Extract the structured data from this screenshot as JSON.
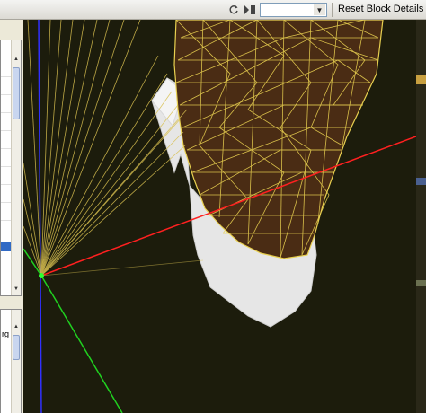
{
  "toolbar": {
    "reset_label": "Reset Block Details",
    "block_select_value": "",
    "icons": [
      "refresh-icon",
      "play-pause-icon",
      "chevron-down-icon"
    ]
  },
  "left_panel": {
    "bottom_item_text": "rg",
    "icons": [
      "close-icon"
    ]
  },
  "viewport": {
    "axis_colors": {
      "x": "#ff2020",
      "y": "#20d020",
      "z": "#3030ff"
    },
    "mesh_wire_color": "#e8d050",
    "mesh_fill_color": "#4a2c14",
    "surface_color": "#e6e6e6",
    "background_color": "#1c1c0c"
  }
}
